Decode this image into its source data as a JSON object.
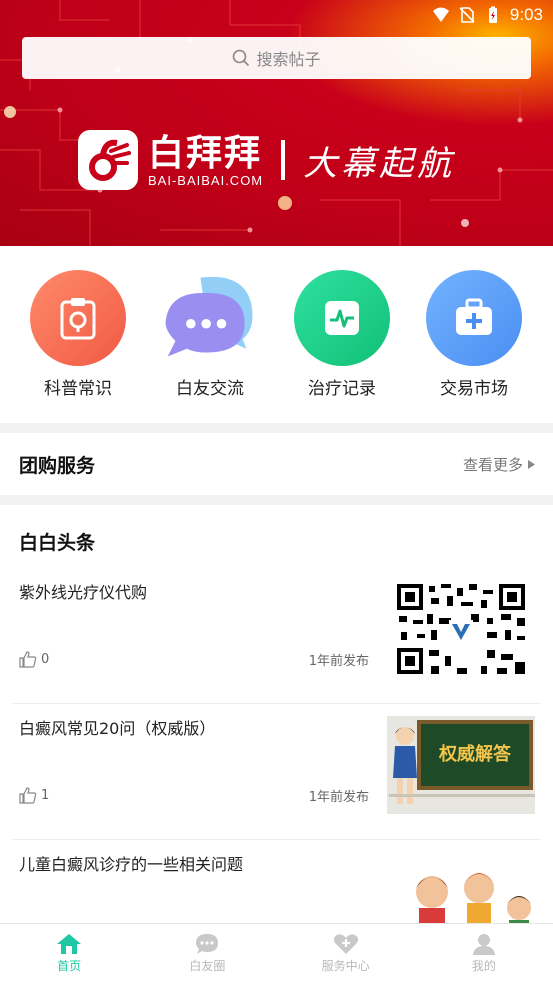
{
  "status_bar": {
    "time": "9:03"
  },
  "search": {
    "placeholder": "搜索帖子"
  },
  "banner": {
    "logo_cn": "白拜拜",
    "logo_en": "BAI-BAIBAI.COM",
    "slogan": "大幕起航"
  },
  "quick_entries": [
    {
      "label": "科普常识",
      "icon": "clipboard-icon",
      "color": "#f7674f"
    },
    {
      "label": "白友交流",
      "icon": "chat-bubbles-icon",
      "color": "#8f8cf0"
    },
    {
      "label": "治疗记录",
      "icon": "heartbeat-monitor-icon",
      "color": "#1fd08a"
    },
    {
      "label": "交易市场",
      "icon": "medical-kit-icon",
      "color": "#5b9bf5"
    }
  ],
  "group_buy": {
    "title": "团购服务",
    "more": "查看更多"
  },
  "headlines": {
    "title": "白白头条",
    "articles": [
      {
        "title": "紫外线光疗仪代购",
        "likes": "0",
        "time": "1年前发布",
        "thumb": "qr-code"
      },
      {
        "title": "白癜风常见20问（权威版）",
        "likes": "1",
        "time": "1年前发布",
        "thumb_text": "权威解答"
      },
      {
        "title": "儿童白癜风诊疗的一些相关问题",
        "thumb": "cartoon-children"
      }
    ]
  },
  "tabbar": [
    {
      "label": "首页",
      "icon": "home-icon",
      "active": true
    },
    {
      "label": "白友圈",
      "icon": "chat-icon",
      "active": false
    },
    {
      "label": "服务中心",
      "icon": "heart-plus-icon",
      "active": false
    },
    {
      "label": "我的",
      "icon": "user-icon",
      "active": false
    }
  ],
  "colors": {
    "accent": "#1ec8a5",
    "banner_red": "#c00018"
  }
}
